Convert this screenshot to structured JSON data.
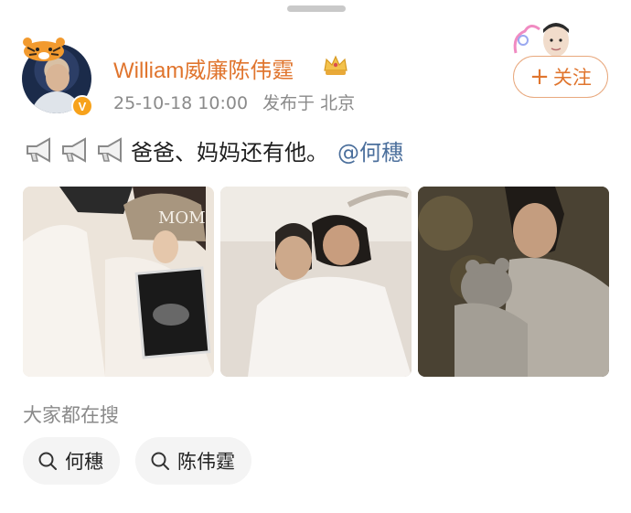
{
  "post": {
    "author": {
      "name": "William威廉陈伟霆",
      "verified": true,
      "badge_color": "#f7a21b",
      "name_color": "#e0752e"
    },
    "meta": {
      "timestamp": "25-10-18 10:00",
      "location": "发布于 北京"
    },
    "follow_button": {
      "label": "关注",
      "icon": "plus-icon"
    },
    "content": {
      "text": "爸爸、妈妈还有他。",
      "mention": "@何穗",
      "mention_color": "#4b6f9c",
      "leading_icons": [
        "megaphone-icon",
        "megaphone-icon",
        "megaphone-icon"
      ]
    },
    "images": [
      {
        "alt": "MOM"
      },
      {
        "alt": ""
      },
      {
        "alt": ""
      }
    ]
  },
  "related_search": {
    "title": "大家都在搜",
    "items": [
      {
        "label": "何穗",
        "icon": "search-icon"
      },
      {
        "label": "陈伟霆",
        "icon": "search-icon"
      }
    ]
  }
}
